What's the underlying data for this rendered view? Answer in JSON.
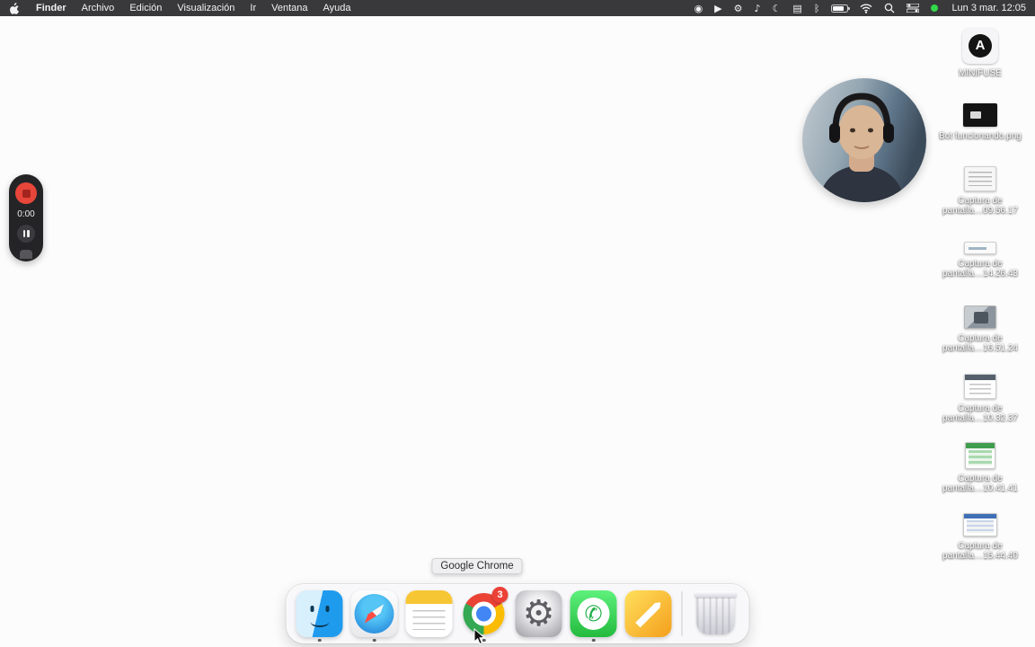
{
  "menu_bar": {
    "app_name": "Finder",
    "menus": [
      "Archivo",
      "Edición",
      "Visualización",
      "Ir",
      "Ventana",
      "Ayuda"
    ],
    "status_glyphs": [
      {
        "id": "screen-mirroring-icon",
        "glyph": "◉"
      },
      {
        "id": "airplay-icon",
        "glyph": "▶"
      },
      {
        "id": "gear-icon",
        "glyph": "⚙"
      },
      {
        "id": "volume-icon",
        "glyph": "♪"
      },
      {
        "id": "focus-moon-icon",
        "glyph": "☾"
      },
      {
        "id": "display-icon",
        "glyph": "▤"
      },
      {
        "id": "bluetooth-icon",
        "glyph": "ᛒ"
      }
    ],
    "clock": "Lun 3 mar. 12:05"
  },
  "recorder": {
    "time": "0:00"
  },
  "desktop_icons": [
    {
      "id": "minifuse",
      "label": "MINIFUSE",
      "kind": "drive"
    },
    {
      "id": "bot-funcionando",
      "label": "Bot funcionando.png",
      "kind": "dark-image"
    },
    {
      "id": "captura-09-56-17",
      "label": "Captura de pantalla…09.56.17",
      "kind": "doc"
    },
    {
      "id": "captura-14-26-43",
      "label": "Captura de pantalla…14.26.43",
      "kind": "wide"
    },
    {
      "id": "captura-16-51-24",
      "label": "Captura de pantalla…16.51.24",
      "kind": "photo"
    },
    {
      "id": "captura-10-32-37",
      "label": "Captura de pantalla…10.32.37",
      "kind": "doc2"
    },
    {
      "id": "captura-10-41-41",
      "label": "Captura de pantalla…10.41.41",
      "kind": "sheet"
    },
    {
      "id": "captura-15-44-40",
      "label": "Captura de pantalla…15.44.40",
      "kind": "table"
    }
  ],
  "dock": {
    "tooltip": "Google Chrome",
    "items": [
      {
        "id": "finder",
        "running": true
      },
      {
        "id": "safari",
        "running": true
      },
      {
        "id": "notes",
        "running": false
      },
      {
        "id": "chrome",
        "running": true,
        "badge": "3"
      },
      {
        "id": "system-settings",
        "running": false
      },
      {
        "id": "whatsapp",
        "running": true
      },
      {
        "id": "pencil-app",
        "running": false
      }
    ]
  }
}
